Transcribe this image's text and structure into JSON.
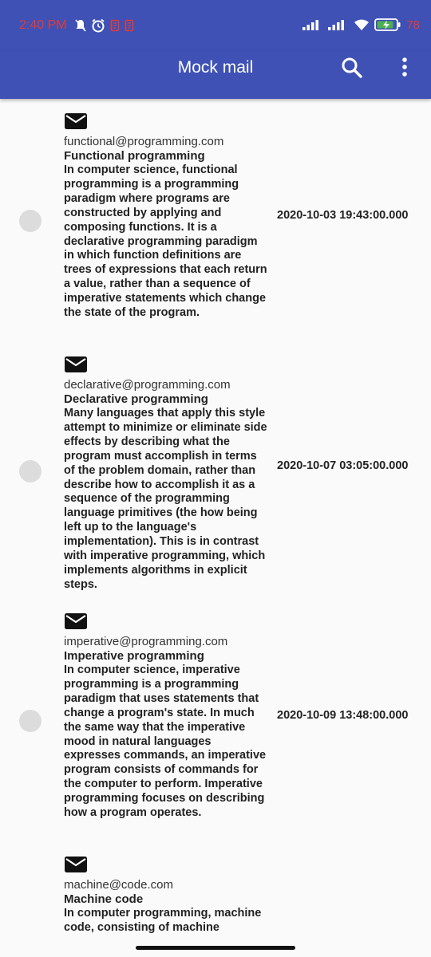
{
  "status_bar": {
    "time": "2:40 PM",
    "battery_percent": "78",
    "icons": [
      "mute-icon",
      "alarm-icon",
      "notification-icon",
      "notification-icon",
      "signal-icon",
      "signal-icon",
      "wifi-icon",
      "battery-charging-icon"
    ]
  },
  "app_bar": {
    "title": "Mock mail",
    "actions": [
      "search-icon",
      "more-vert-icon"
    ]
  },
  "mails": [
    {
      "from": "functional@programming.com",
      "subject": "Functional programming",
      "body": "In computer science, functional programming is a programming paradigm where programs are constructed by applying and composing functions. It is a declarative programming paradigm in which function definitions are trees of expressions that each return a value, rather than a sequence of imperative statements which change the state of the program.",
      "date": "2020-10-03 19:43:00.000"
    },
    {
      "from": "declarative@programming.com",
      "subject": "Declarative programming",
      "body": "Many languages that apply this style attempt to minimize or eliminate side effects by describing what the program must accomplish in terms of the problem domain, rather than describe how to accomplish it as a sequence of the programming language primitives (the how being left up to the language's implementation). This is in contrast with imperative programming, which implements algorithms in explicit steps.",
      "date": "2020-10-07 03:05:00.000"
    },
    {
      "from": "imperative@programming.com",
      "subject": "Imperative programming",
      "body": "In computer science, imperative programming is a programming paradigm that uses statements that change a program's state. In much the same way that the imperative mood in natural languages expresses commands, an imperative program consists of commands for the computer to perform. Imperative programming focuses on describing how a program operates.",
      "date": "2020-10-09 13:48:00.000"
    },
    {
      "from": "machine@code.com",
      "subject": "Machine code",
      "body": "In computer programming, machine code, consisting of machine",
      "date": ""
    }
  ],
  "colors": {
    "app_bar": "#3f51b5",
    "status_time": "#e53935",
    "background": "#fafafa",
    "avatar": "#dcdcdc"
  }
}
